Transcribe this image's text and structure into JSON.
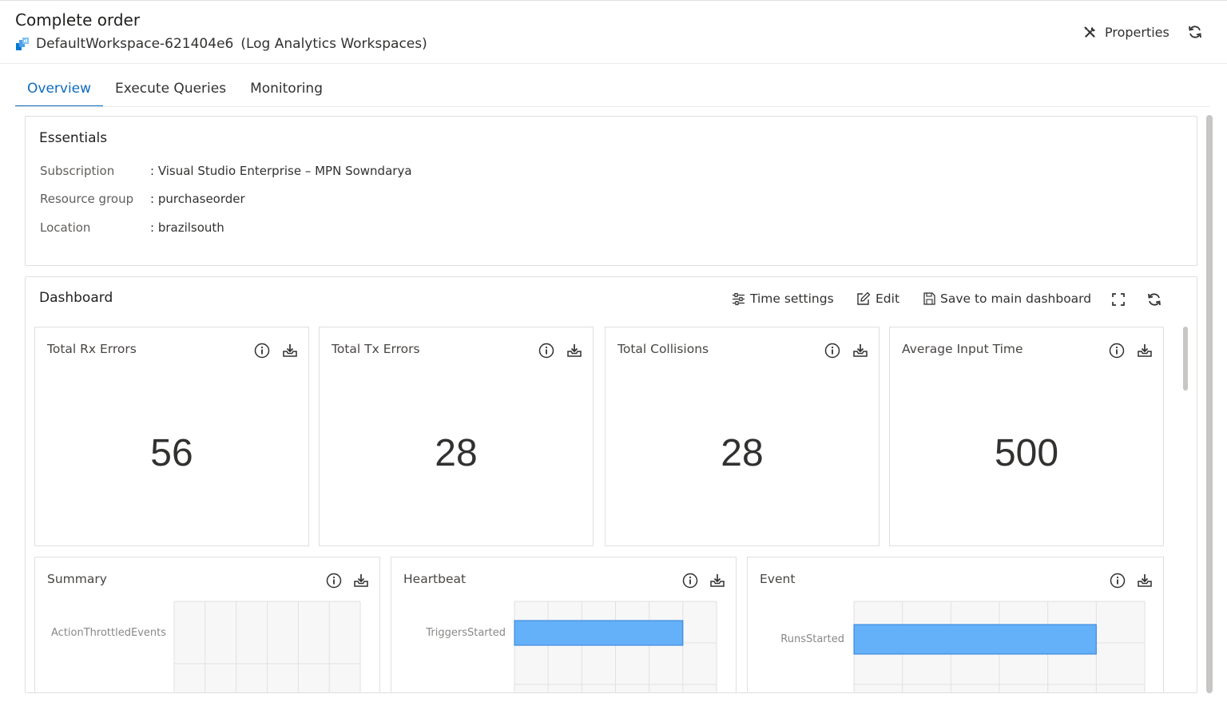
{
  "header": {
    "title": "Complete order",
    "workspace_name": "DefaultWorkspace-621404e6",
    "workspace_type": "(Log Analytics Workspaces)",
    "properties_label": "Properties"
  },
  "tabs": [
    {
      "label": "Overview",
      "active": true
    },
    {
      "label": "Execute Queries",
      "active": false
    },
    {
      "label": "Monitoring",
      "active": false
    }
  ],
  "essentials": {
    "title": "Essentials",
    "rows": [
      {
        "label": "Subscription",
        "value": ": Visual Studio Enterprise – MPN Sowndarya"
      },
      {
        "label": "Resource group",
        "value": ": purchaseorder"
      },
      {
        "label": "Location",
        "value": ": brazilsouth"
      }
    ]
  },
  "dashboard": {
    "title": "Dashboard",
    "time_settings_label": "Time settings",
    "edit_label": "Edit",
    "save_label": "Save to main dashboard",
    "metric_tiles": [
      {
        "title": "Total Rx Errors",
        "value": "56"
      },
      {
        "title": "Total Tx Errors",
        "value": "28"
      },
      {
        "title": "Total Collisions",
        "value": "28"
      },
      {
        "title": "Average Input Time",
        "value": "500"
      }
    ],
    "chart_tiles": [
      {
        "title": "Summary"
      },
      {
        "title": "Heartbeat"
      },
      {
        "title": "Event"
      }
    ]
  },
  "colors": {
    "accent": "#0f6cbd",
    "bar": "#64b1fa",
    "bar_border": "#2f7fd6"
  },
  "chart_data": [
    {
      "type": "bar",
      "orientation": "horizontal",
      "title": "Summary",
      "categories": [
        "ActionThrottledEvents"
      ],
      "values": [
        0
      ],
      "grid": true
    },
    {
      "type": "bar",
      "orientation": "horizontal",
      "title": "Heartbeat",
      "categories": [
        "TriggersStarted"
      ],
      "values": [
        1
      ],
      "xlim": [
        0,
        1.2
      ],
      "grid": true
    },
    {
      "type": "bar",
      "orientation": "horizontal",
      "title": "Event",
      "categories": [
        "RunsStarted"
      ],
      "values": [
        1
      ],
      "xlim": [
        0,
        1.2
      ],
      "grid": true
    }
  ]
}
